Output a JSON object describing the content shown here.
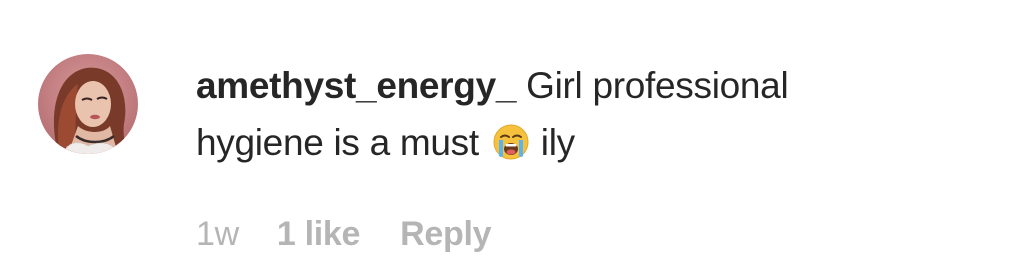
{
  "comment": {
    "username": "amethyst_energy_",
    "text_line1": "Girl professional",
    "text_line2": "hygiene is a must",
    "emoji": "loudly-crying-face-emoji",
    "text_after_emoji": "ily",
    "timestamp": "1w",
    "likes": "1 like",
    "reply_label": "Reply"
  },
  "colors": {
    "text": "#262626",
    "meta": "#b5b5b5"
  }
}
